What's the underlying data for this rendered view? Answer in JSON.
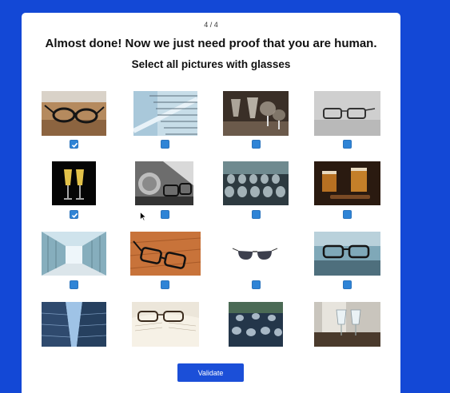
{
  "captcha": {
    "progress": "4 / 4",
    "title": "Almost done! Now we just need proof that you are human.",
    "instruction": "Select all pictures with glasses",
    "validate_label": "Validate",
    "tiles": [
      {
        "name": "eyeglasses-on-wood",
        "checked": true
      },
      {
        "name": "glass-building-facade",
        "checked": false
      },
      {
        "name": "drinking-glasses-dark",
        "checked": false
      },
      {
        "name": "eyeglasses-on-gray",
        "checked": false
      },
      {
        "name": "champagne-glasses",
        "checked": true
      },
      {
        "name": "glasses-bw-desk",
        "checked": false
      },
      {
        "name": "wine-glasses-rows",
        "checked": false
      },
      {
        "name": "whiskey-glasses",
        "checked": false
      },
      {
        "name": "glass-corridor",
        "checked": false
      },
      {
        "name": "eyeglasses-on-floor",
        "checked": false
      },
      {
        "name": "sunglasses-white",
        "checked": false
      },
      {
        "name": "eyeglasses-on-laptop",
        "checked": false
      },
      {
        "name": "glass-skyscrapers",
        "checked": false
      },
      {
        "name": "eyeglasses-on-book",
        "checked": false
      },
      {
        "name": "wine-glasses-table",
        "checked": false
      },
      {
        "name": "glasses-on-tray",
        "checked": false
      }
    ]
  }
}
